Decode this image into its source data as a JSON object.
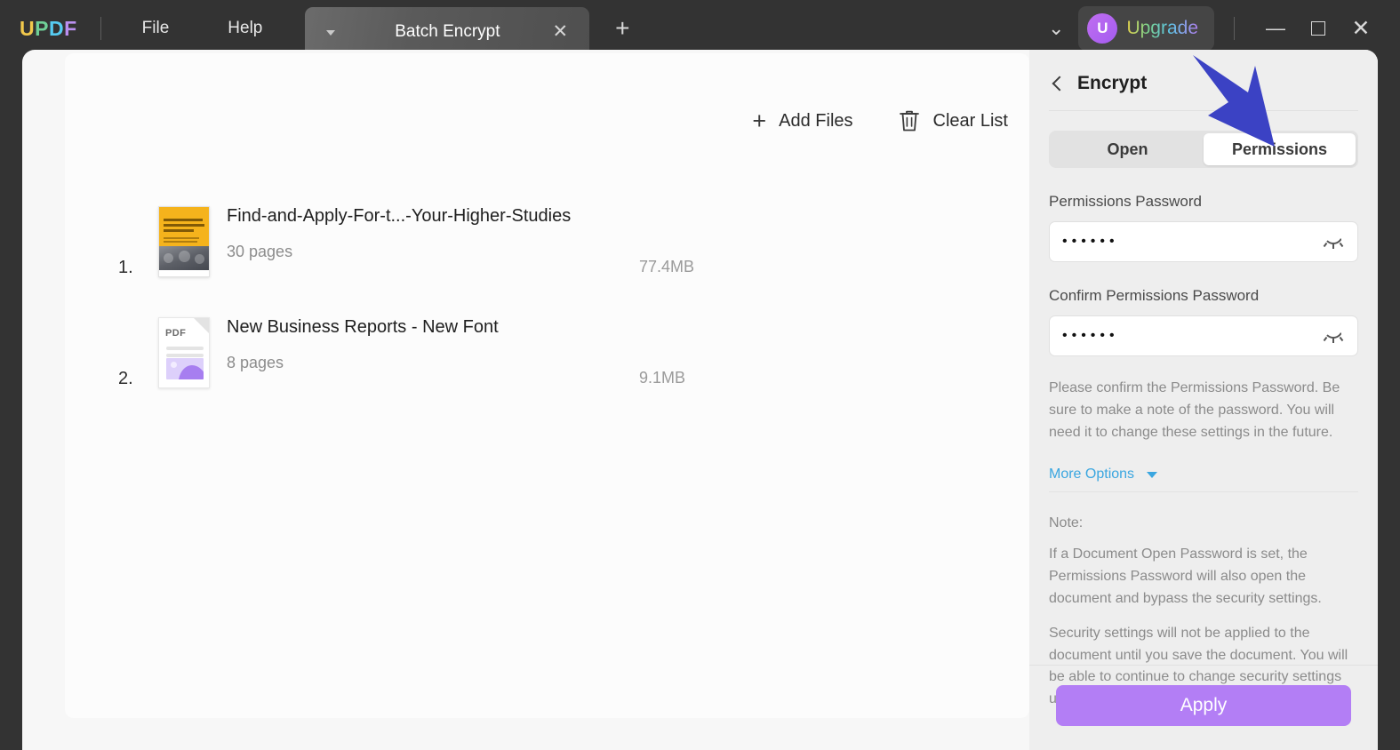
{
  "titlebar": {
    "logo_letters": [
      "U",
      "P",
      "D",
      "F"
    ],
    "menus": [
      "File",
      "Help"
    ],
    "tab": {
      "title": "Batch Encrypt",
      "close_label": "✕",
      "caret": "chevron-down-icon"
    },
    "new_tab_label": "+",
    "chevron_label": "⌄",
    "upgrade": {
      "badge": "U",
      "label": "Upgrade"
    },
    "window_controls": {
      "minimize": "—",
      "maximize": "",
      "close": "✕"
    }
  },
  "main": {
    "actions": [
      {
        "icon": "plus-icon",
        "label": "Add Files"
      },
      {
        "icon": "trash-icon",
        "label": "Clear List"
      }
    ],
    "files": [
      {
        "index": "1.",
        "name": "Find-and-Apply-For-t...-Your-Higher-Studies",
        "pages": "30 pages",
        "size": "77.4MB",
        "thumb": "cover-thumbnail"
      },
      {
        "index": "2.",
        "name": "New Business Reports - New Font",
        "pages": "8 pages",
        "size": "9.1MB",
        "thumb": "pdf-file-icon",
        "thumb_label": "PDF"
      }
    ]
  },
  "right_panel": {
    "title": "Encrypt",
    "back_icon": "chevron-left-icon",
    "tabs": [
      {
        "label": "Open",
        "active": false
      },
      {
        "label": "Permissions",
        "active": true
      }
    ],
    "permissions_password": {
      "label": "Permissions Password",
      "value": "••••••",
      "toggle_icon": "eye-closed-icon"
    },
    "confirm_password": {
      "label": "Confirm Permissions Password",
      "value": "••••••",
      "toggle_icon": "eye-closed-icon"
    },
    "hint": "Please confirm the Permissions Password. Be sure to make a note of the password. You will need it to change these settings in the future.",
    "more_options": {
      "label": "More Options",
      "caret": "caret-down-icon"
    },
    "note_title": "Note:",
    "note_paragraphs": [
      "If a Document Open Password is set, the Permissions Password will also open the document and bypass the security settings.",
      "Security settings will not be applied to the document until you save the document. You will be able to continue to change security settings until you close the document."
    ],
    "apply_label": "Apply"
  },
  "annotation": {
    "arrow": "blue-arrow-pointing-to-permissions-tab",
    "color": "#3b42c4"
  },
  "colors": {
    "titlebar_bg": "#333333",
    "workspace_bg": "#f7f7f7",
    "panel_bg": "#eeeeee",
    "apply_button": "#b37ef5",
    "link_blue": "#3aa6e0",
    "arrow_blue": "#3b42c4"
  }
}
